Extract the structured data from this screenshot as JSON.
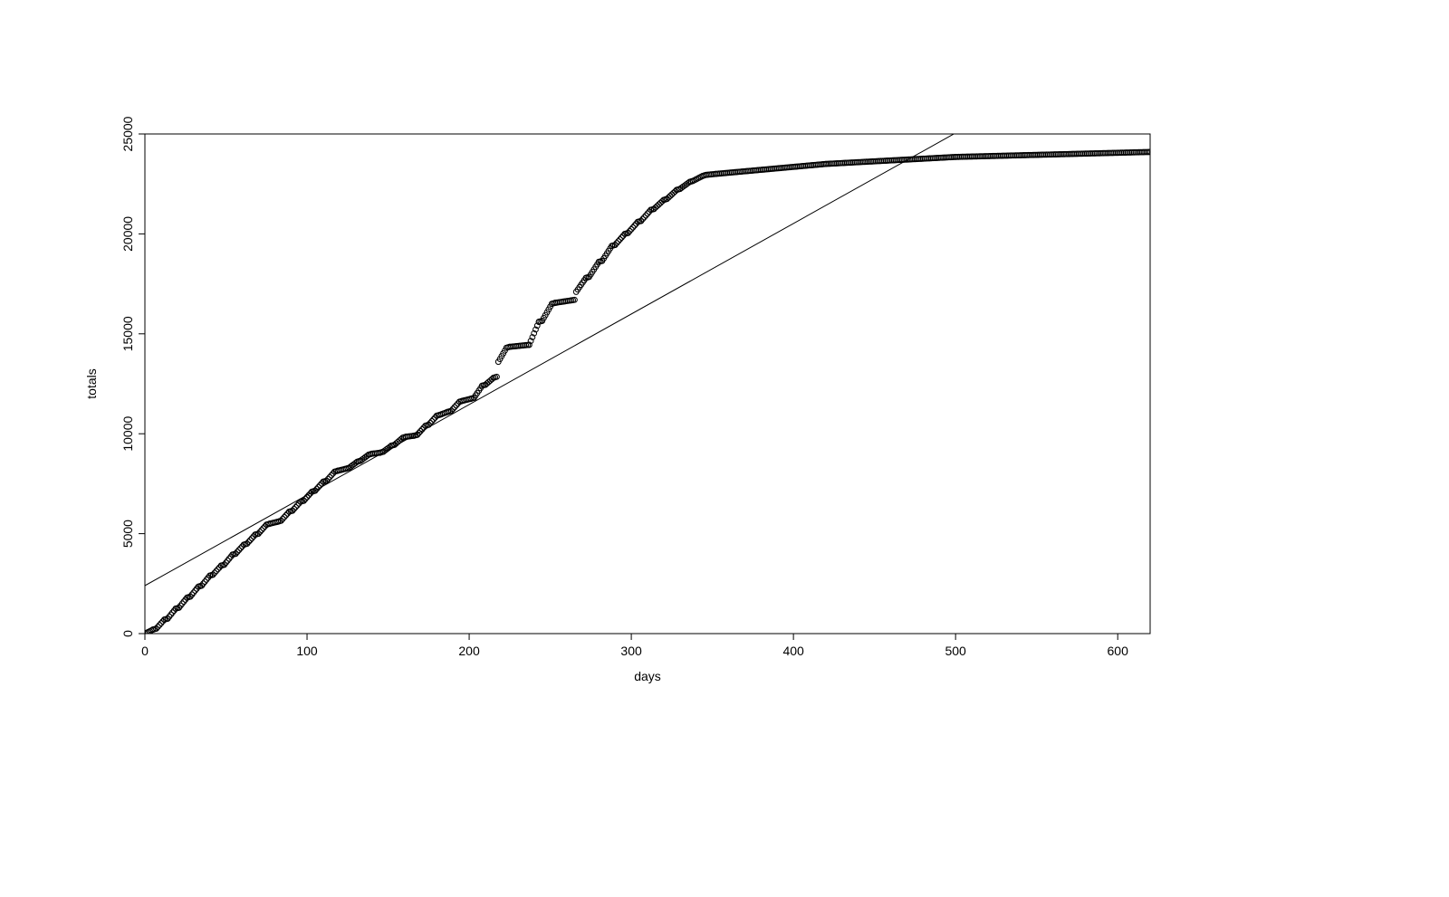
{
  "chart_data": {
    "type": "scatter",
    "xlabel": "days",
    "ylabel": "totals",
    "xlim": [
      0,
      620
    ],
    "ylim": [
      0,
      25000
    ],
    "x_ticks": [
      0,
      100,
      200,
      300,
      400,
      500,
      600
    ],
    "y_ticks": [
      0,
      5000,
      10000,
      15000,
      20000,
      25000
    ],
    "fit_line": {
      "intercept": 2400,
      "slope": 45.3
    },
    "series": [
      {
        "name": "totals-scatter",
        "segments": [
          {
            "x0": 0,
            "y0": 0,
            "x1": 5,
            "y1": 200
          },
          {
            "x0": 5,
            "y0": 200,
            "x1": 7,
            "y1": 250
          },
          {
            "x0": 7,
            "y0": 250,
            "x1": 12,
            "y1": 700
          },
          {
            "x0": 12,
            "y0": 700,
            "x1": 14,
            "y1": 750
          },
          {
            "x0": 14,
            "y0": 750,
            "x1": 19,
            "y1": 1250
          },
          {
            "x0": 19,
            "y0": 1250,
            "x1": 21,
            "y1": 1300
          },
          {
            "x0": 21,
            "y0": 1300,
            "x1": 26,
            "y1": 1800
          },
          {
            "x0": 26,
            "y0": 1800,
            "x1": 28,
            "y1": 1850
          },
          {
            "x0": 28,
            "y0": 1850,
            "x1": 33,
            "y1": 2350
          },
          {
            "x0": 33,
            "y0": 2350,
            "x1": 35,
            "y1": 2400
          },
          {
            "x0": 35,
            "y0": 2400,
            "x1": 40,
            "y1": 2900
          },
          {
            "x0": 40,
            "y0": 2900,
            "x1": 42,
            "y1": 2950
          },
          {
            "x0": 42,
            "y0": 2950,
            "x1": 47,
            "y1": 3400
          },
          {
            "x0": 47,
            "y0": 3400,
            "x1": 49,
            "y1": 3450
          },
          {
            "x0": 49,
            "y0": 3450,
            "x1": 54,
            "y1": 3950
          },
          {
            "x0": 54,
            "y0": 3950,
            "x1": 56,
            "y1": 4000
          },
          {
            "x0": 56,
            "y0": 4000,
            "x1": 61,
            "y1": 4450
          },
          {
            "x0": 61,
            "y0": 4450,
            "x1": 63,
            "y1": 4500
          },
          {
            "x0": 63,
            "y0": 4500,
            "x1": 68,
            "y1": 4950
          },
          {
            "x0": 68,
            "y0": 4950,
            "x1": 70,
            "y1": 5000
          },
          {
            "x0": 70,
            "y0": 5000,
            "x1": 75,
            "y1": 5450
          },
          {
            "x0": 75,
            "y0": 5450,
            "x1": 77,
            "y1": 5500
          },
          {
            "x0": 77,
            "y0": 5500,
            "x1": 82,
            "y1": 5600
          },
          {
            "x0": 82,
            "y0": 5600,
            "x1": 84,
            "y1": 5650
          },
          {
            "x0": 84,
            "y0": 5650,
            "x1": 89,
            "y1": 6100
          },
          {
            "x0": 89,
            "y0": 6100,
            "x1": 91,
            "y1": 6150
          },
          {
            "x0": 91,
            "y0": 6150,
            "x1": 96,
            "y1": 6600
          },
          {
            "x0": 96,
            "y0": 6600,
            "x1": 98,
            "y1": 6650
          },
          {
            "x0": 98,
            "y0": 6650,
            "x1": 103,
            "y1": 7100
          },
          {
            "x0": 103,
            "y0": 7100,
            "x1": 105,
            "y1": 7150
          },
          {
            "x0": 105,
            "y0": 7150,
            "x1": 110,
            "y1": 7600
          },
          {
            "x0": 110,
            "y0": 7600,
            "x1": 112,
            "y1": 7650
          },
          {
            "x0": 112,
            "y0": 7650,
            "x1": 117,
            "y1": 8100
          },
          {
            "x0": 117,
            "y0": 8100,
            "x1": 119,
            "y1": 8150
          },
          {
            "x0": 119,
            "y0": 8150,
            "x1": 124,
            "y1": 8250
          },
          {
            "x0": 124,
            "y0": 8250,
            "x1": 126,
            "y1": 8300
          },
          {
            "x0": 126,
            "y0": 8300,
            "x1": 131,
            "y1": 8600
          },
          {
            "x0": 131,
            "y0": 8600,
            "x1": 133,
            "y1": 8650
          },
          {
            "x0": 133,
            "y0": 8650,
            "x1": 138,
            "y1": 8950
          },
          {
            "x0": 138,
            "y0": 8950,
            "x1": 140,
            "y1": 9000
          },
          {
            "x0": 140,
            "y0": 9000,
            "x1": 145,
            "y1": 9050
          },
          {
            "x0": 145,
            "y0": 9050,
            "x1": 147,
            "y1": 9100
          },
          {
            "x0": 147,
            "y0": 9100,
            "x1": 152,
            "y1": 9400
          },
          {
            "x0": 152,
            "y0": 9400,
            "x1": 154,
            "y1": 9450
          },
          {
            "x0": 154,
            "y0": 9450,
            "x1": 159,
            "y1": 9800
          },
          {
            "x0": 159,
            "y0": 9800,
            "x1": 161,
            "y1": 9850
          },
          {
            "x0": 161,
            "y0": 9850,
            "x1": 166,
            "y1": 9900
          },
          {
            "x0": 166,
            "y0": 9900,
            "x1": 168,
            "y1": 9950
          },
          {
            "x0": 168,
            "y0": 9950,
            "x1": 173,
            "y1": 10400
          },
          {
            "x0": 173,
            "y0": 10400,
            "x1": 175,
            "y1": 10450
          },
          {
            "x0": 175,
            "y0": 10450,
            "x1": 180,
            "y1": 10900
          },
          {
            "x0": 180,
            "y0": 10900,
            "x1": 182,
            "y1": 10950
          },
          {
            "x0": 182,
            "y0": 10950,
            "x1": 187,
            "y1": 11100
          },
          {
            "x0": 187,
            "y0": 11100,
            "x1": 189,
            "y1": 11150
          },
          {
            "x0": 189,
            "y0": 11150,
            "x1": 194,
            "y1": 11600
          },
          {
            "x0": 194,
            "y0": 11600,
            "x1": 196,
            "y1": 11650
          },
          {
            "x0": 196,
            "y0": 11650,
            "x1": 201,
            "y1": 11750
          },
          {
            "x0": 201,
            "y0": 11750,
            "x1": 203,
            "y1": 11800
          },
          {
            "x0": 203,
            "y0": 11800,
            "x1": 208,
            "y1": 12400
          },
          {
            "x0": 208,
            "y0": 12400,
            "x1": 210,
            "y1": 12450
          },
          {
            "x0": 210,
            "y0": 12450,
            "x1": 215,
            "y1": 12800
          },
          {
            "x0": 215,
            "y0": 12800,
            "x1": 217,
            "y1": 12850
          },
          {
            "x0": 218,
            "y0": 13600,
            "x1": 223,
            "y1": 14300
          },
          {
            "x0": 223,
            "y0": 14300,
            "x1": 225,
            "y1": 14350
          },
          {
            "x0": 225,
            "y0": 14350,
            "x1": 237,
            "y1": 14450
          },
          {
            "x0": 237,
            "y0": 14450,
            "x1": 243,
            "y1": 15600
          },
          {
            "x0": 243,
            "y0": 15600,
            "x1": 245,
            "y1": 15650
          },
          {
            "x0": 245,
            "y0": 15650,
            "x1": 251,
            "y1": 16500
          },
          {
            "x0": 251,
            "y0": 16500,
            "x1": 253,
            "y1": 16550
          },
          {
            "x0": 253,
            "y0": 16550,
            "x1": 265,
            "y1": 16700
          },
          {
            "x0": 266,
            "y0": 17100,
            "x1": 272,
            "y1": 17800
          },
          {
            "x0": 272,
            "y0": 17800,
            "x1": 274,
            "y1": 17850
          },
          {
            "x0": 274,
            "y0": 17850,
            "x1": 280,
            "y1": 18600
          },
          {
            "x0": 280,
            "y0": 18600,
            "x1": 282,
            "y1": 18650
          },
          {
            "x0": 282,
            "y0": 18650,
            "x1": 288,
            "y1": 19400
          },
          {
            "x0": 288,
            "y0": 19400,
            "x1": 290,
            "y1": 19450
          },
          {
            "x0": 290,
            "y0": 19450,
            "x1": 296,
            "y1": 20000
          },
          {
            "x0": 296,
            "y0": 20000,
            "x1": 298,
            "y1": 20050
          },
          {
            "x0": 298,
            "y0": 20050,
            "x1": 304,
            "y1": 20600
          },
          {
            "x0": 304,
            "y0": 20600,
            "x1": 306,
            "y1": 20650
          },
          {
            "x0": 306,
            "y0": 20650,
            "x1": 312,
            "y1": 21200
          },
          {
            "x0": 312,
            "y0": 21200,
            "x1": 314,
            "y1": 21250
          },
          {
            "x0": 314,
            "y0": 21250,
            "x1": 320,
            "y1": 21700
          },
          {
            "x0": 320,
            "y0": 21700,
            "x1": 322,
            "y1": 21750
          },
          {
            "x0": 322,
            "y0": 21750,
            "x1": 328,
            "y1": 22200
          },
          {
            "x0": 328,
            "y0": 22200,
            "x1": 330,
            "y1": 22250
          },
          {
            "x0": 330,
            "y0": 22250,
            "x1": 336,
            "y1": 22600
          },
          {
            "x0": 336,
            "y0": 22600,
            "x1": 338,
            "y1": 22650
          },
          {
            "x0": 338,
            "y0": 22650,
            "x1": 344,
            "y1": 22900
          },
          {
            "x0": 344,
            "y0": 22900,
            "x1": 346,
            "y1": 22950
          },
          {
            "x0": 346,
            "y0": 22950,
            "x1": 352,
            "y1": 23000
          },
          {
            "x0": 352,
            "y0": 23000,
            "x1": 420,
            "y1": 23500
          },
          {
            "x0": 420,
            "y0": 23500,
            "x1": 500,
            "y1": 23850
          },
          {
            "x0": 500,
            "y0": 23850,
            "x1": 620,
            "y1": 24100
          }
        ]
      }
    ]
  }
}
